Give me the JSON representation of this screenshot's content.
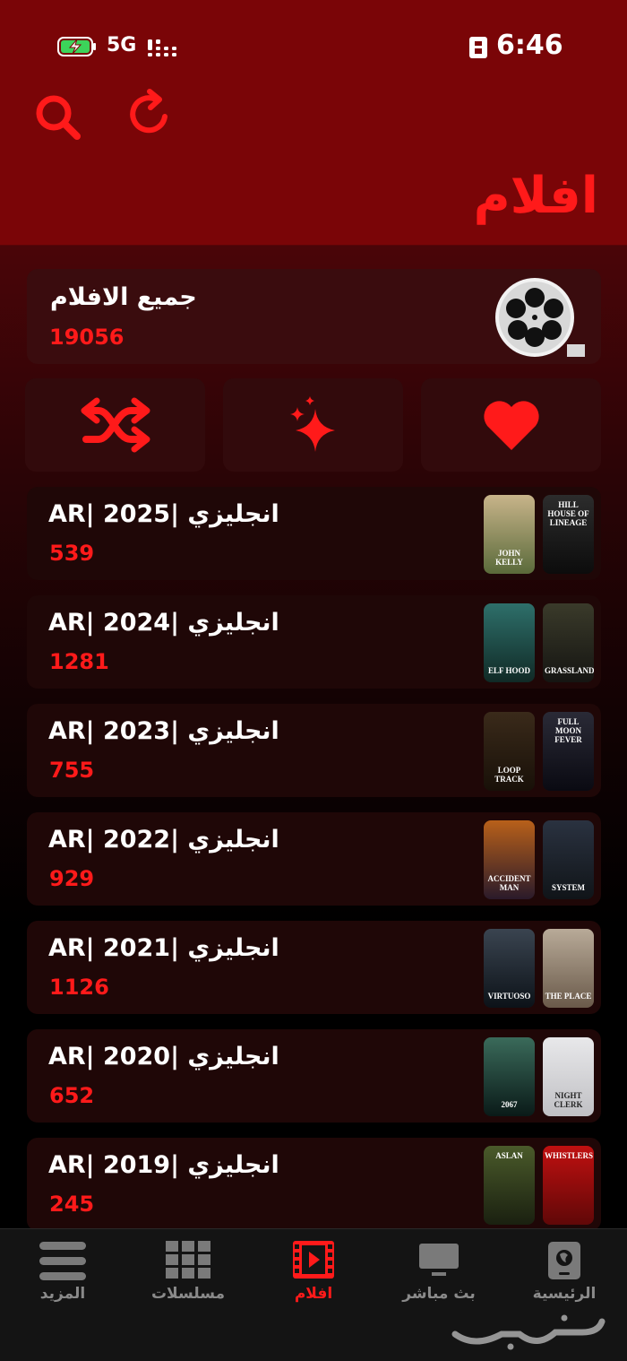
{
  "status_bar": {
    "network": "5G",
    "time": "6:46"
  },
  "header": {
    "title": "افلام"
  },
  "all_movies": {
    "title": "جميع الافلام",
    "count": "19056"
  },
  "actions": [
    {
      "name": "shuffle"
    },
    {
      "name": "sparkles"
    },
    {
      "name": "favorites"
    }
  ],
  "categories": [
    {
      "title": "انجليزي |AR| 2025",
      "count": "539",
      "posters": [
        "JOHN KELLY",
        "HILL HOUSE OF LINEAGE"
      ],
      "poster_colors": [
        [
          "#c8b48a",
          "#5a6a3a"
        ],
        [
          "#2c2c2c",
          "#0c0c0c"
        ]
      ]
    },
    {
      "title": "انجليزي |AR| 2024",
      "count": "1281",
      "posters": [
        "ELF HOOD",
        "GRASSLAND"
      ],
      "poster_colors": [
        [
          "#2e6f6a",
          "#102a26"
        ],
        [
          "#3a3a2a",
          "#151512"
        ]
      ]
    },
    {
      "title": "انجليزي |AR| 2023",
      "count": "755",
      "posters": [
        "LOOP TRACK",
        "FULL MOON FEVER"
      ],
      "poster_colors": [
        [
          "#3a2a1a",
          "#181008"
        ],
        [
          "#2a2a36",
          "#0a0a12"
        ]
      ]
    },
    {
      "title": "انجليزي |AR| 2022",
      "count": "929",
      "posters": [
        "ACCIDENT MAN",
        "SYSTEM"
      ],
      "poster_colors": [
        [
          "#b8601a",
          "#2a1a2a"
        ],
        [
          "#2a3240",
          "#101418"
        ]
      ]
    },
    {
      "title": "انجليزي |AR| 2021",
      "count": "1126",
      "posters": [
        "VIRTUOSO",
        "THE PLACE"
      ],
      "poster_colors": [
        [
          "#3a4450",
          "#0c1218"
        ],
        [
          "#b8aa98",
          "#6a5a4a"
        ]
      ]
    },
    {
      "title": "انجليزي |AR| 2020",
      "count": "652",
      "posters": [
        "2067",
        "NIGHT CLERK"
      ],
      "poster_colors": [
        [
          "#3a6a5a",
          "#0a1a18"
        ],
        [
          "#e8e8ea",
          "#c0c0c4"
        ]
      ]
    },
    {
      "title": "انجليزي |AR| 2019",
      "count": "245",
      "posters": [
        "ASLAN",
        "WHISTLERS"
      ],
      "poster_colors": [
        [
          "#4a5a2a",
          "#1a2010"
        ],
        [
          "#c01010",
          "#600808"
        ]
      ]
    }
  ],
  "bottom_nav": [
    {
      "label": "المزيد",
      "icon": "menu-icon"
    },
    {
      "label": "مسلسلات",
      "icon": "grid-icon"
    },
    {
      "label": "افلام",
      "icon": "film-icon",
      "active": true
    },
    {
      "label": "بث مباشر",
      "icon": "tv-icon"
    },
    {
      "label": "الرئيسية",
      "icon": "home-icon"
    }
  ],
  "colors": {
    "accent": "#ff1a1a",
    "header": "#7a0507"
  }
}
